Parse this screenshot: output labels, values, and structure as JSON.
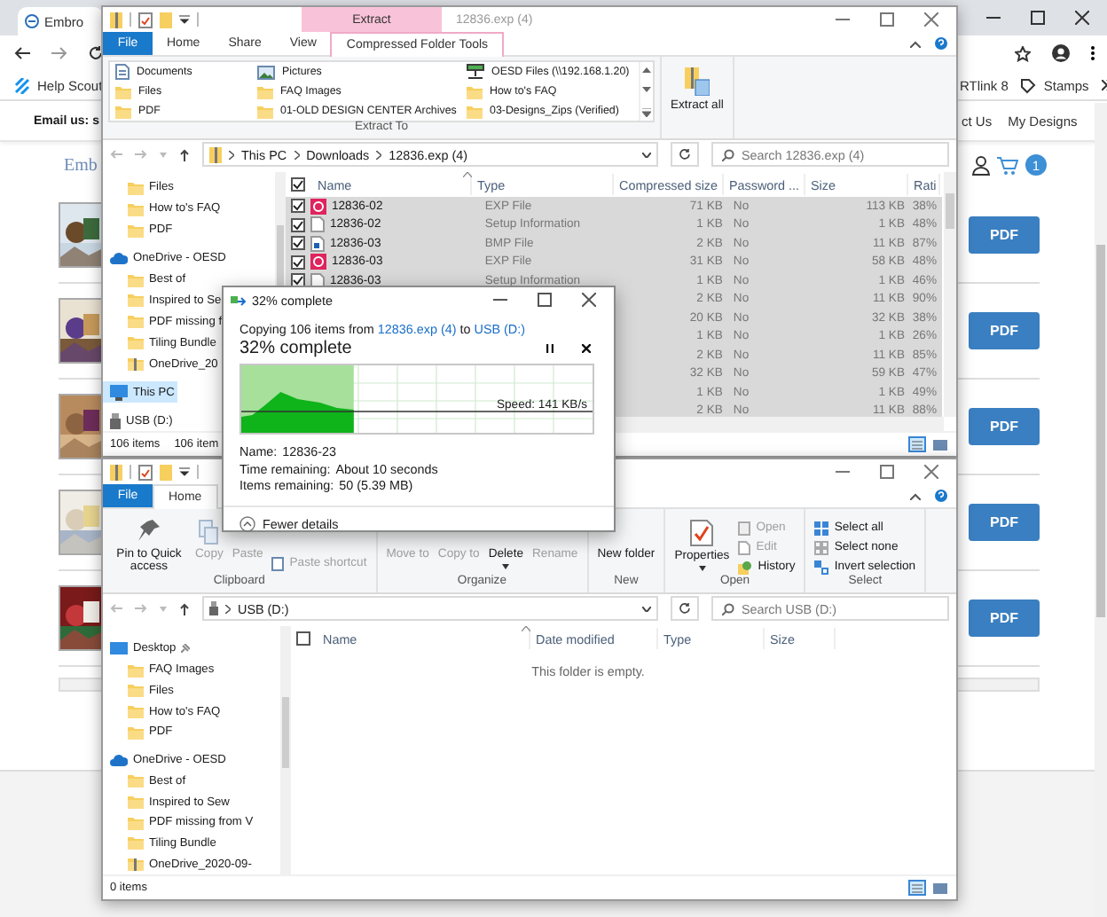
{
  "browser": {
    "tab_title": "Embro",
    "bookmarks": [
      {
        "label": "Help Scout",
        "kind": "helpscout"
      },
      {
        "label": "RTlink 8",
        "kind": "plain"
      },
      {
        "label": "Stamps",
        "kind": "tag"
      }
    ],
    "contact": "Email us: s",
    "nav_links": [
      "ct Us",
      "My Designs"
    ],
    "logo": "Emb",
    "cart_count": "1",
    "listings": [
      {
        "button": "PDF"
      },
      {
        "button": "PDF"
      },
      {
        "button": "PDF"
      },
      {
        "button": "PDF"
      },
      {
        "button": "PDF"
      }
    ]
  },
  "top_explorer": {
    "title": "12836.exp (4)",
    "context_header": "Extract",
    "tabs": [
      {
        "label": "File",
        "kind": "file",
        "selected": false
      },
      {
        "label": "Home",
        "kind": "normal",
        "selected": false
      },
      {
        "label": "Share",
        "kind": "normal",
        "selected": false
      },
      {
        "label": "View",
        "kind": "normal",
        "selected": false
      },
      {
        "label": "Compressed Folder Tools",
        "kind": "context",
        "selected": true
      }
    ],
    "ribbon": {
      "kind": "extract",
      "group_label": "Extract To",
      "action": "Extract all",
      "destinations": [
        {
          "label": "Documents",
          "kind": "document"
        },
        {
          "label": "Files",
          "kind": "folder"
        },
        {
          "label": "PDF",
          "kind": "folder"
        },
        {
          "label": "Pictures",
          "kind": "pictures"
        },
        {
          "label": "FAQ Images",
          "kind": "folder"
        },
        {
          "label": "01-OLD DESIGN CENTER Archives",
          "kind": "folder"
        },
        {
          "label": "OESD Files (\\\\192.168.1.20)",
          "kind": "network"
        },
        {
          "label": "How to's  FAQ",
          "kind": "folder"
        },
        {
          "label": "03-Designs_Zips (Verified)",
          "kind": "folder"
        }
      ]
    },
    "path": [
      "This PC",
      "Downloads",
      "12836.exp (4)"
    ],
    "search_placeholder": "Search 12836.exp (4)",
    "nav_items": [
      {
        "label": "Files",
        "kind": "folder",
        "selected": false
      },
      {
        "label": "How to's  FAQ",
        "kind": "folder",
        "selected": false
      },
      {
        "label": "PDF",
        "kind": "folder",
        "selected": false
      },
      {
        "label": "OneDrive - OESD",
        "kind": "cloud",
        "selected": false
      },
      {
        "label": "Best of",
        "kind": "folder",
        "selected": false
      },
      {
        "label": "Inspired to Se",
        "kind": "folder",
        "selected": false
      },
      {
        "label": "PDF missing f",
        "kind": "folder",
        "selected": false
      },
      {
        "label": "Tiling Bundle",
        "kind": "folder",
        "selected": false
      },
      {
        "label": "OneDrive_20",
        "kind": "zip",
        "selected": false
      },
      {
        "label": "This PC",
        "kind": "pc",
        "selected": true
      },
      {
        "label": "USB (D:)",
        "kind": "drive",
        "selected": false
      }
    ],
    "all_checked": true,
    "columns": [
      "Name",
      "Type",
      "Compressed size",
      "Password ...",
      "Size",
      "Rati"
    ],
    "rows": [
      {
        "name": "12836-02",
        "kind": "exp",
        "type": "EXP File",
        "compressed": "71 KB",
        "password": "No",
        "size": "113 KB",
        "ratio": "38%",
        "selected": true
      },
      {
        "name": "12836-02",
        "kind": "inf",
        "type": "Setup Information",
        "compressed": "1 KB",
        "password": "No",
        "size": "1 KB",
        "ratio": "48%",
        "selected": true
      },
      {
        "name": "12836-03",
        "kind": "bmp",
        "type": "BMP File",
        "compressed": "2 KB",
        "password": "No",
        "size": "11 KB",
        "ratio": "87%",
        "selected": true
      },
      {
        "name": "12836-03",
        "kind": "exp",
        "type": "EXP File",
        "compressed": "31 KB",
        "password": "No",
        "size": "58 KB",
        "ratio": "48%",
        "selected": true
      },
      {
        "name": "12836-03",
        "kind": "inf",
        "type": "Setup Information",
        "compressed": "1 KB",
        "password": "No",
        "size": "1 KB",
        "ratio": "46%",
        "selected": true
      },
      {
        "compressed": "2 KB",
        "password": "No",
        "size": "11 KB",
        "ratio": "90%",
        "selected": true
      },
      {
        "compressed": "20 KB",
        "password": "No",
        "size": "32 KB",
        "ratio": "38%",
        "selected": true
      },
      {
        "compressed": "1 KB",
        "password": "No",
        "size": "1 KB",
        "ratio": "26%",
        "selected": true
      },
      {
        "compressed": "2 KB",
        "password": "No",
        "size": "11 KB",
        "ratio": "85%",
        "selected": true
      },
      {
        "compressed": "32 KB",
        "password": "No",
        "size": "59 KB",
        "ratio": "47%",
        "selected": true
      },
      {
        "compressed": "1 KB",
        "password": "No",
        "size": "1 KB",
        "ratio": "49%",
        "selected": true
      },
      {
        "compressed": "2 KB",
        "password": "No",
        "size": "11 KB",
        "ratio": "88%",
        "selected": true
      }
    ],
    "status": [
      "106 items",
      "106 item"
    ]
  },
  "copy_dialog": {
    "title": "32% complete",
    "prefix": "Copying 106 items from",
    "source": "12836.exp (4)",
    "joiner": "to",
    "destination": "USB (D:)",
    "heading": "32% complete",
    "level": 0.32,
    "speed": "Speed: 141 KB/s",
    "details": [
      {
        "label": "Name:",
        "value": "12836-23"
      },
      {
        "label": "Time remaining:",
        "value": "About 10 seconds"
      },
      {
        "label": "Items remaining:",
        "value": "50 (5.39 MB)"
      }
    ],
    "toggle": "Fewer details"
  },
  "bottom_explorer": {
    "tabs": [
      {
        "label": "File",
        "kind": "file",
        "selected": false
      },
      {
        "label": "Home",
        "kind": "normal",
        "selected": true
      }
    ],
    "ribbon": {
      "kind": "home",
      "groups": [
        {
          "label": "Clipboard",
          "commands": [
            {
              "label": "Pin to Quick access",
              "kind": "pin",
              "disabled": false
            },
            {
              "label": "Copy",
              "kind": "copy",
              "disabled": true
            },
            {
              "label": "Paste",
              "kind": "paste",
              "disabled": true
            },
            {
              "label": "Paste shortcut",
              "kind": "shortcut",
              "disabled": true
            }
          ]
        },
        {
          "label": "Organize",
          "commands": [
            {
              "label": "Move to",
              "kind": "move",
              "disabled": true
            },
            {
              "label": "Copy to",
              "kind": "copyto",
              "disabled": true
            },
            {
              "label": "Delete",
              "kind": "delete",
              "disabled": false
            },
            {
              "label": "Rename",
              "kind": "rename",
              "disabled": true
            }
          ]
        },
        {
          "label": "New",
          "commands": [
            {
              "label": "New folder",
              "kind": "newfolder",
              "disabled": false
            }
          ]
        },
        {
          "label": "Open",
          "commands": [
            {
              "label": "Properties",
              "kind": "properties",
              "disabled": false
            },
            {
              "label": "Open",
              "kind": "open",
              "disabled": true
            },
            {
              "label": "Edit",
              "kind": "edit",
              "disabled": true
            },
            {
              "label": "History",
              "kind": "history",
              "disabled": false
            }
          ]
        },
        {
          "label": "Select",
          "commands": [
            {
              "label": "Select all",
              "kind": "selectall",
              "disabled": false
            },
            {
              "label": "Select none",
              "kind": "selectnone",
              "disabled": false
            },
            {
              "label": "Invert selection",
              "kind": "invert",
              "disabled": false
            }
          ]
        }
      ]
    },
    "path": [
      "USB (D:)"
    ],
    "search_placeholder": "Search USB (D:)",
    "nav_items": [
      {
        "label": "Desktop",
        "kind": "desktop",
        "selected": false
      },
      {
        "label": "FAQ Images",
        "kind": "folder",
        "selected": false
      },
      {
        "label": "Files",
        "kind": "folder",
        "selected": false
      },
      {
        "label": "How to's  FAQ",
        "kind": "folder",
        "selected": false
      },
      {
        "label": "PDF",
        "kind": "folder",
        "selected": false
      },
      {
        "label": "OneDrive - OESD",
        "kind": "cloud",
        "selected": false
      },
      {
        "label": "Best of",
        "kind": "folder",
        "selected": false
      },
      {
        "label": "Inspired to Sew",
        "kind": "folder",
        "selected": false
      },
      {
        "label": "PDF missing from V",
        "kind": "folder",
        "selected": false
      },
      {
        "label": "Tiling Bundle",
        "kind": "folder",
        "selected": false
      },
      {
        "label": "OneDrive_2020-09-",
        "kind": "zip",
        "selected": false
      }
    ],
    "all_checked": false,
    "columns": [
      "Name",
      "Date modified",
      "Type",
      "Size"
    ],
    "empty_message": "This folder is empty.",
    "status": [
      "0 items"
    ]
  }
}
